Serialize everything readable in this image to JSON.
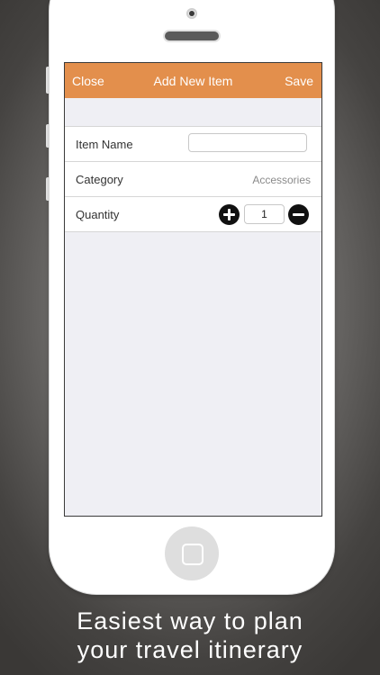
{
  "navbar": {
    "close_label": "Close",
    "title": "Add New Item",
    "save_label": "Save",
    "color": "#e38f4c"
  },
  "form": {
    "item_name": {
      "label": "Item Name",
      "value": ""
    },
    "category": {
      "label": "Category",
      "value": "Accessories"
    },
    "quantity": {
      "label": "Quantity",
      "value": "1"
    }
  },
  "caption": {
    "line1": "Easiest way to plan",
    "line2": "your travel itinerary"
  },
  "icons": {
    "increase": "plus-circle-icon",
    "decrease": "minus-circle-icon",
    "home": "home-button-icon"
  }
}
